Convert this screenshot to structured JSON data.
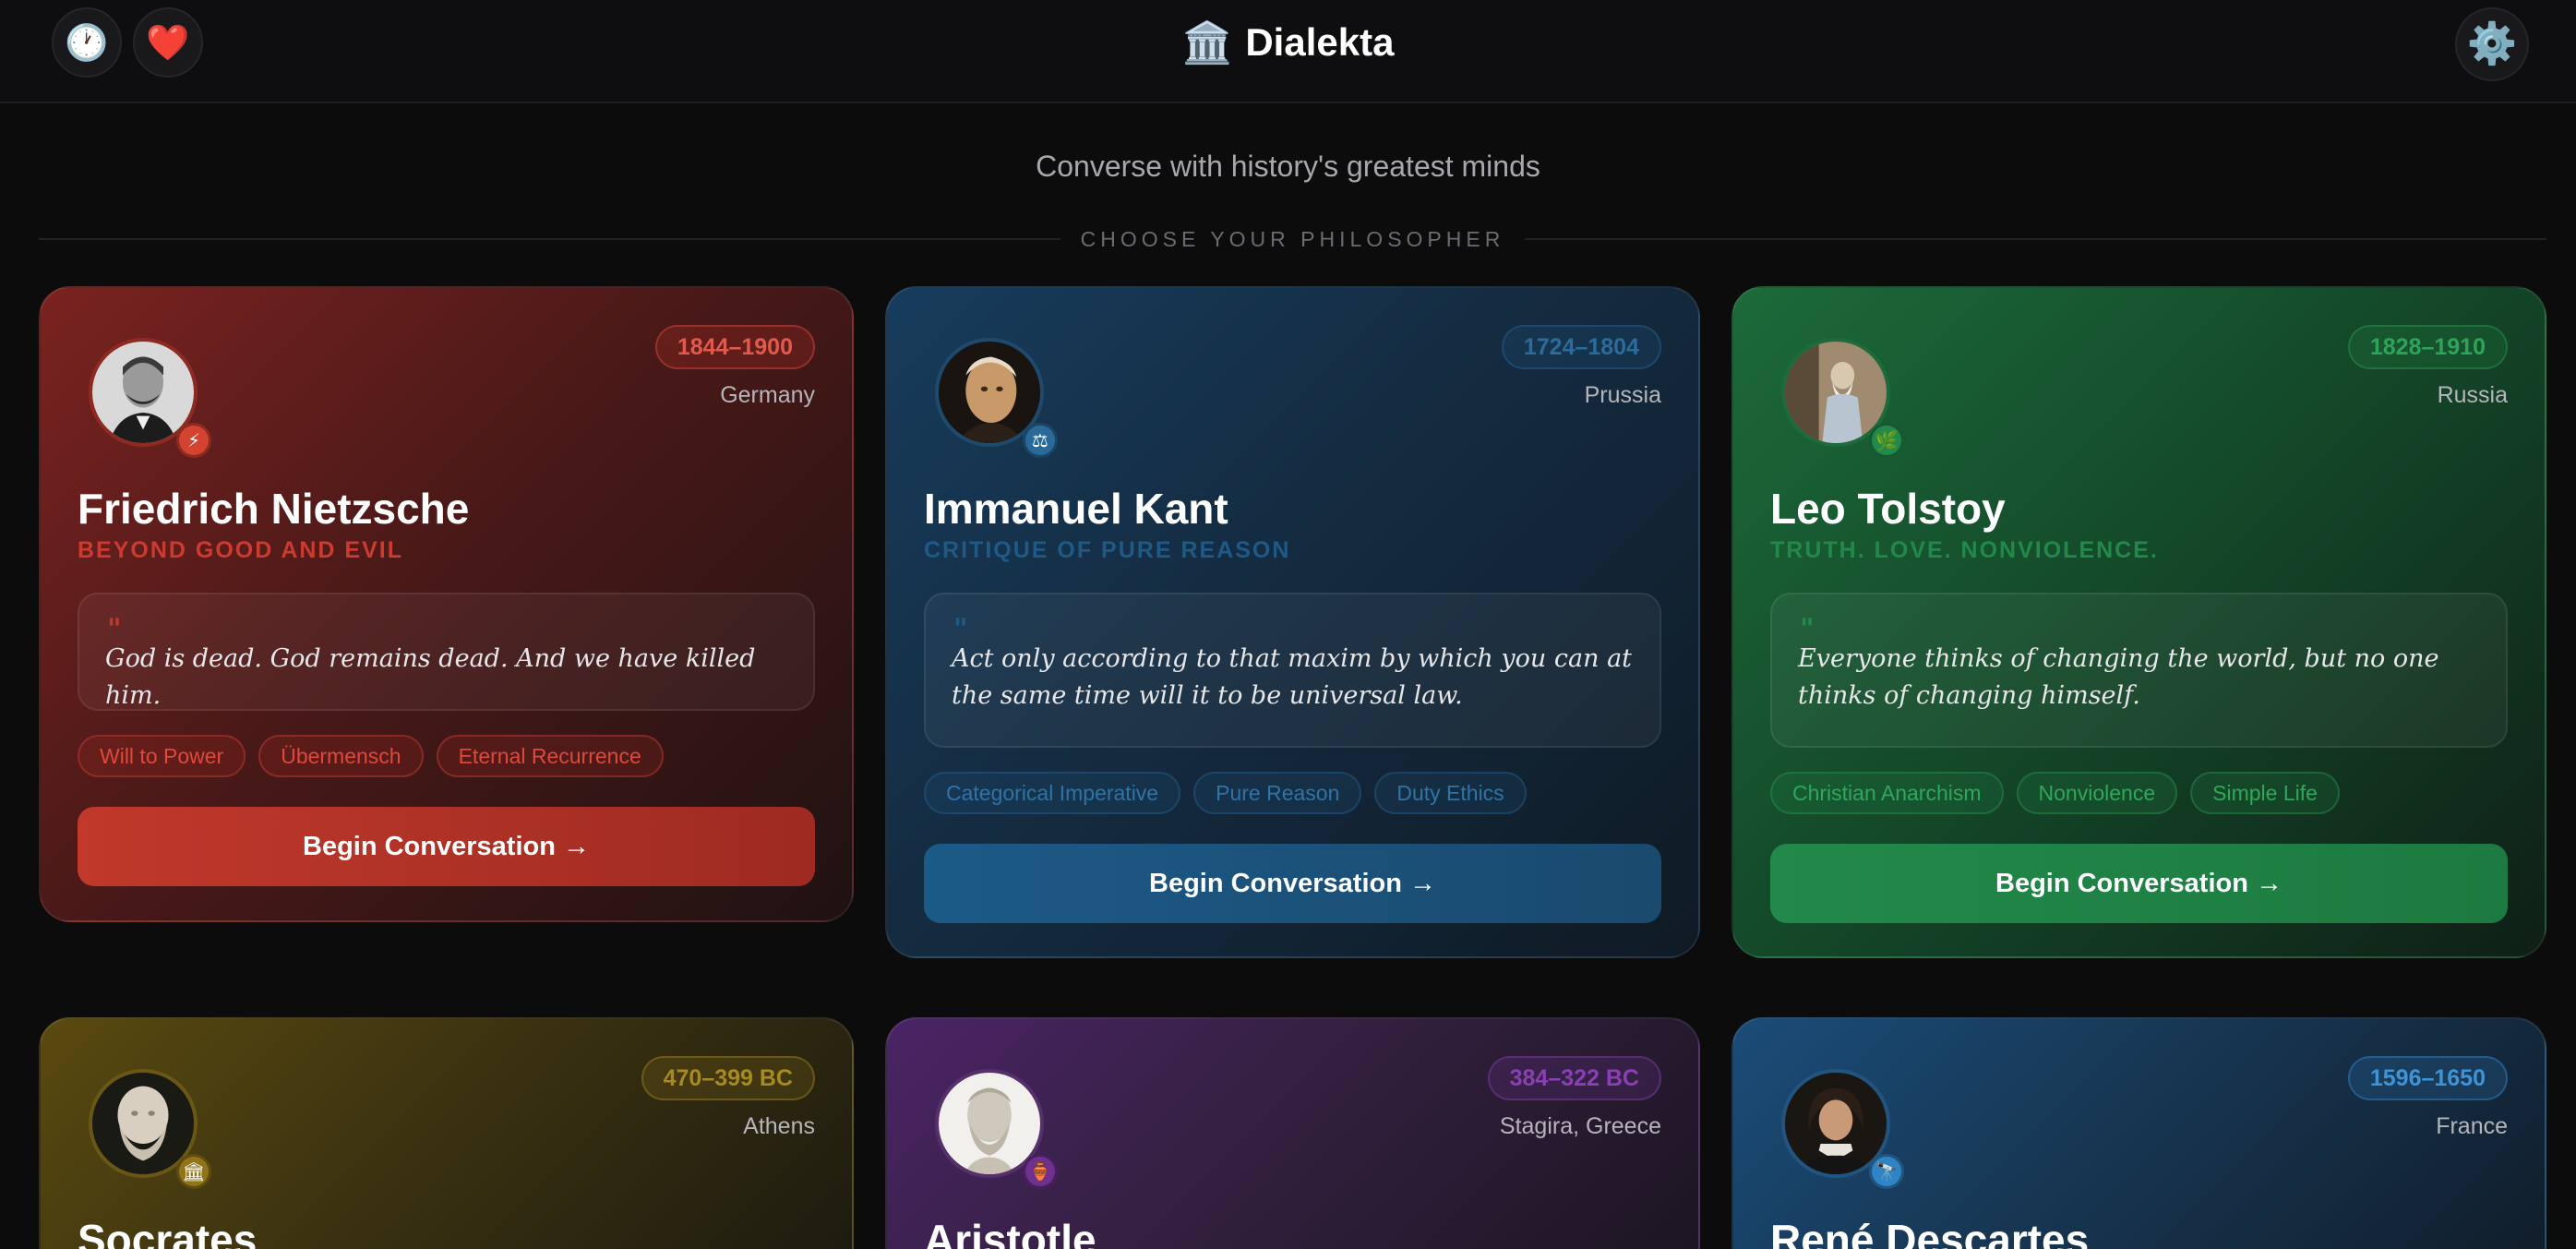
{
  "header": {
    "brand_icon": "🏛️",
    "brand_name": "Dialekta",
    "history_icon": "🕐",
    "favorites_icon": "❤️",
    "settings_icon": "⚙️"
  },
  "tagline": "Converse with history's greatest minds",
  "section_label": "CHOOSE YOUR PHILOSOPHER",
  "cta_label": "Begin Conversation →",
  "quote_mark": "\"",
  "philosophers": [
    {
      "name": "Friedrich Nietzsche",
      "work": "BEYOND GOOD AND EVIL",
      "dates": "1844–1900",
      "origin": "Germany",
      "badge": "⚡",
      "quote": "God is dead. God remains dead. And we have killed him.",
      "tags": [
        "Will to Power",
        "Übermensch",
        "Eternal Recurrence"
      ],
      "accent": "#c0392b"
    },
    {
      "name": "Immanuel Kant",
      "work": "CRITIQUE OF PURE REASON",
      "dates": "1724–1804",
      "origin": "Prussia",
      "badge": "⚖",
      "quote": "Act only according to that maxim by which you can at the same time will it to be universal law.",
      "tags": [
        "Categorical Imperative",
        "Pure Reason",
        "Duty Ethics"
      ],
      "accent": "#1c5a87"
    },
    {
      "name": "Leo Tolstoy",
      "work": "TRUTH. LOVE. NONVIOLENCE.",
      "dates": "1828–1910",
      "origin": "Russia",
      "badge": "🌿",
      "quote": "Everyone thinks of changing the world, but no one thinks of changing himself.",
      "tags": [
        "Christian Anarchism",
        "Nonviolence",
        "Simple Life"
      ],
      "accent": "#22894a"
    },
    {
      "name": "Socrates",
      "dates": "470–399 BC",
      "origin": "Athens",
      "badge": "🏛",
      "accent": "#8f7418"
    },
    {
      "name": "Aristotle",
      "dates": "384–322 BC",
      "origin": "Stagira, Greece",
      "badge": "🏺",
      "accent": "#6e318f"
    },
    {
      "name": "René Descartes",
      "dates": "1596–1650",
      "origin": "France",
      "badge": "🔭",
      "accent": "#2f84c6"
    }
  ]
}
